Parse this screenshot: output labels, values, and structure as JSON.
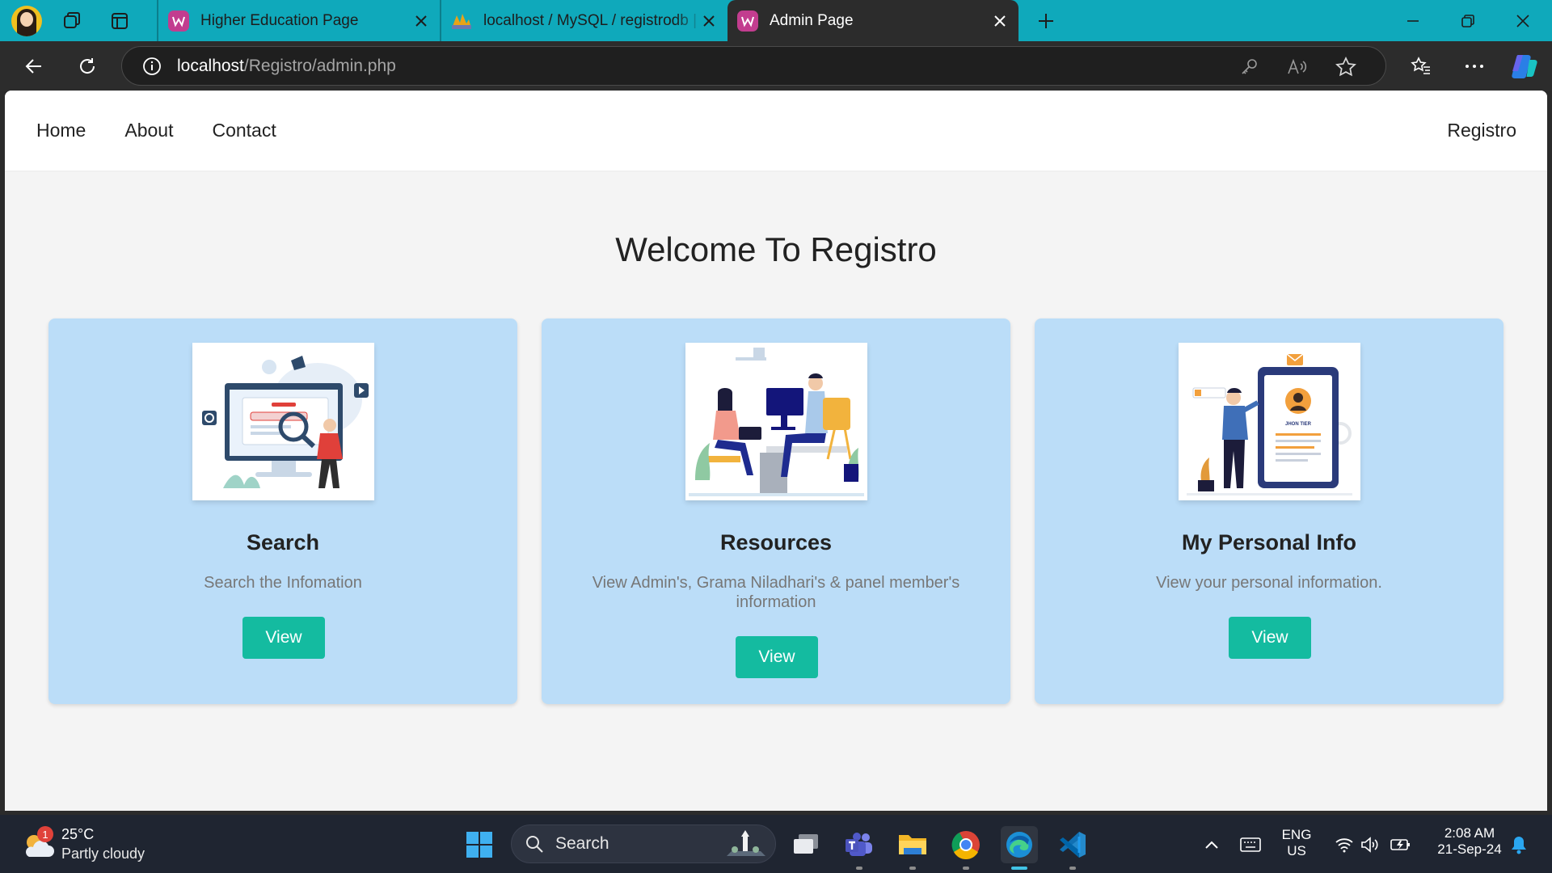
{
  "browser": {
    "tabs": [
      {
        "title": "Higher Education Page",
        "active": false
      },
      {
        "title": "localhost / MySQL / registrodb | phpMyAdmin",
        "active": false
      },
      {
        "title": "Admin Page",
        "active": true
      }
    ],
    "url_host": "localhost",
    "url_path": "/Registro/admin.php"
  },
  "site": {
    "nav": [
      "Home",
      "About",
      "Contact"
    ],
    "brand": "Registro",
    "welcome": "Welcome To Registro",
    "cards": [
      {
        "title": "Search",
        "description": "Search the Infomation",
        "button": "View",
        "illustration": "search-illustration"
      },
      {
        "title": "Resources",
        "description": "View Admin's, Grama Niladhari's & panel member's information",
        "button": "View",
        "illustration": "team-illustration"
      },
      {
        "title": "My Personal Info",
        "description": "View your personal information.",
        "button": "View",
        "illustration": "profile-illustration"
      }
    ],
    "profile_card_name": "JHON TIER"
  },
  "taskbar": {
    "weather_temp": "25°C",
    "weather_desc": "Partly cloudy",
    "weather_badge": "1",
    "search_label": "Search",
    "lang_top": "ENG",
    "lang_bottom": "US",
    "time": "2:08 AM",
    "date": "21-Sep-24"
  },
  "colors": {
    "tab_strip": "#0fa9bb",
    "card_bg": "#bbddf8",
    "button": "#14bba0",
    "page_bg": "#f4f4f4"
  }
}
